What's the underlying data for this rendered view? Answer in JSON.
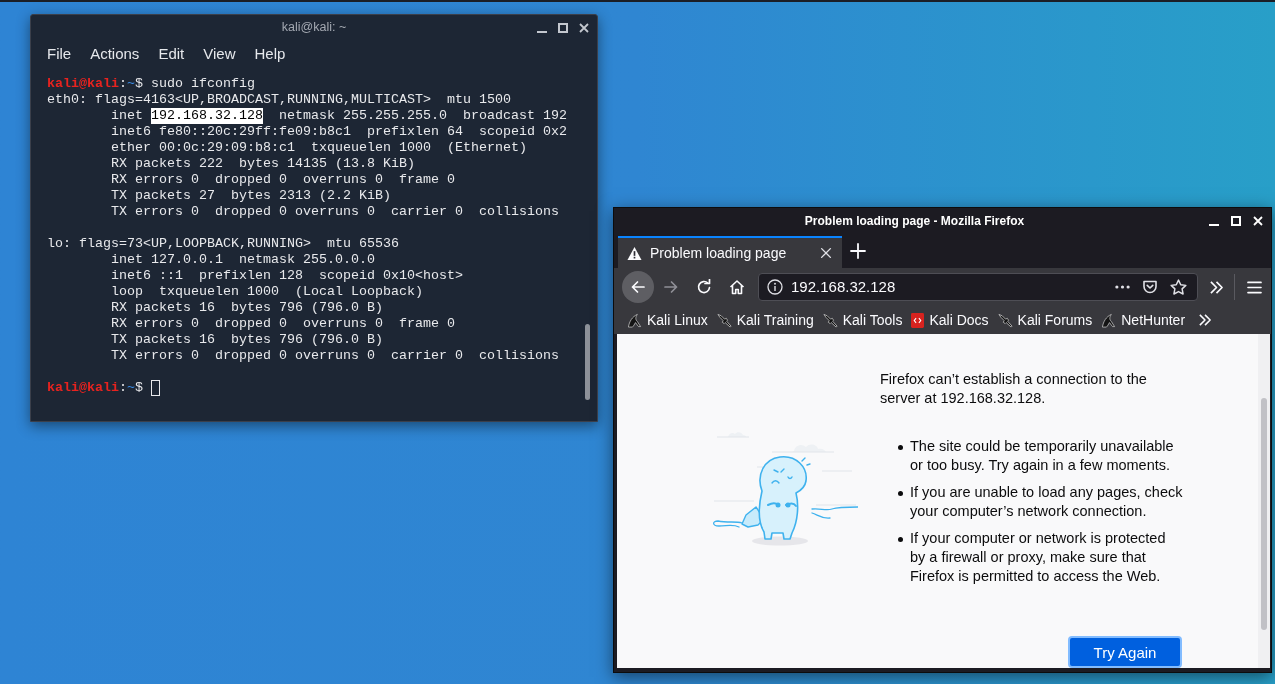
{
  "terminal": {
    "title": "kali@kali: ~",
    "menu": [
      "File",
      "Actions",
      "Edit",
      "View",
      "Help"
    ],
    "lines": [
      {
        "kind": "prompt",
        "user": "kali@kali",
        "separator": ":",
        "path": "~",
        "symbol": "$",
        "command": "sudo ifconfig"
      },
      {
        "kind": "output",
        "text": "eth0: flags=4163<UP,BROADCAST,RUNNING,MULTICAST>  mtu 1500",
        "children": [
          {
            "segments": [
              {
                "text": "inet ",
                "selected": false
              },
              {
                "text": "192.168.32.128",
                "selected": true
              },
              {
                "text": "  netmask 255.255.255.0  broadcast 192",
                "selected": false
              }
            ]
          },
          {
            "text": "inet6 fe80::20c:29ff:fe09:b8c1  prefixlen 64  scopeid 0x2"
          },
          {
            "text": "ether 00:0c:29:09:b8:c1  txqueuelen 1000  (Ethernet)"
          },
          {
            "text": "RX packets 222  bytes 14135 (13.8 KiB)"
          },
          {
            "text": "RX errors 0  dropped 0  overruns 0  frame 0"
          },
          {
            "text": "TX packets 27  bytes 2313 (2.2 KiB)"
          },
          {
            "text": "TX errors 0  dropped 0 overruns 0  carrier 0  collisions"
          }
        ]
      },
      {
        "kind": "output",
        "text": "lo: flags=73<UP,LOOPBACK,RUNNING>  mtu 65536",
        "children": [
          {
            "text": "inet 127.0.0.1  netmask 255.0.0.0"
          },
          {
            "text": "inet6 ::1  prefixlen 128  scopeid 0x10<host>"
          },
          {
            "text": "loop  txqueuelen 1000  (Local Loopback)"
          },
          {
            "text": "RX packets 16  bytes 796 (796.0 B)"
          },
          {
            "text": "RX errors 0  dropped 0  overruns 0  frame 0"
          },
          {
            "text": "TX packets 16  bytes 796 (796.0 B)"
          },
          {
            "text": "TX errors 0  dropped 0 overruns 0  carrier 0  collisions"
          }
        ]
      },
      {
        "kind": "prompt",
        "user": "kali@kali",
        "separator": ":",
        "path": "~",
        "symbol": "$",
        "cursor": true
      }
    ]
  },
  "browser": {
    "title": "Problem loading page - Mozilla Firefox",
    "tabs": [
      {
        "label": "Problem loading page",
        "selected": true
      }
    ],
    "nav_buttons": [
      {
        "kind": "back",
        "disabled": false,
        "hovered": true
      },
      {
        "kind": "forward",
        "disabled": true,
        "hovered": false
      },
      {
        "kind": "reload",
        "disabled": false,
        "hovered": false
      },
      {
        "kind": "home",
        "disabled": false,
        "hovered": false
      }
    ],
    "url": "192.168.32.128",
    "bookmarks": [
      {
        "kind": "dragon",
        "label": "Kali Linux"
      },
      {
        "kind": "blade",
        "label": "Kali Training"
      },
      {
        "kind": "blade",
        "label": "Kali Tools"
      },
      {
        "kind": "docs",
        "label": "Kali Docs"
      },
      {
        "kind": "blade",
        "label": "Kali Forums"
      },
      {
        "kind": "dragon",
        "label": "NetHunter"
      }
    ],
    "page": {
      "message": "Firefox can’t establish a connection to the server at 192.168.32.128.",
      "suggestions": [
        "The site could be temporarily unavailable or too busy. Try again in a few moments.",
        "If you are unable to load any pages, check your computer’s network connection.",
        "If your computer or network is protected by a firewall or proxy, make sure that Firefox is permitted to access the Web."
      ],
      "button": {
        "label": "Try Again",
        "focused": true
      }
    }
  }
}
